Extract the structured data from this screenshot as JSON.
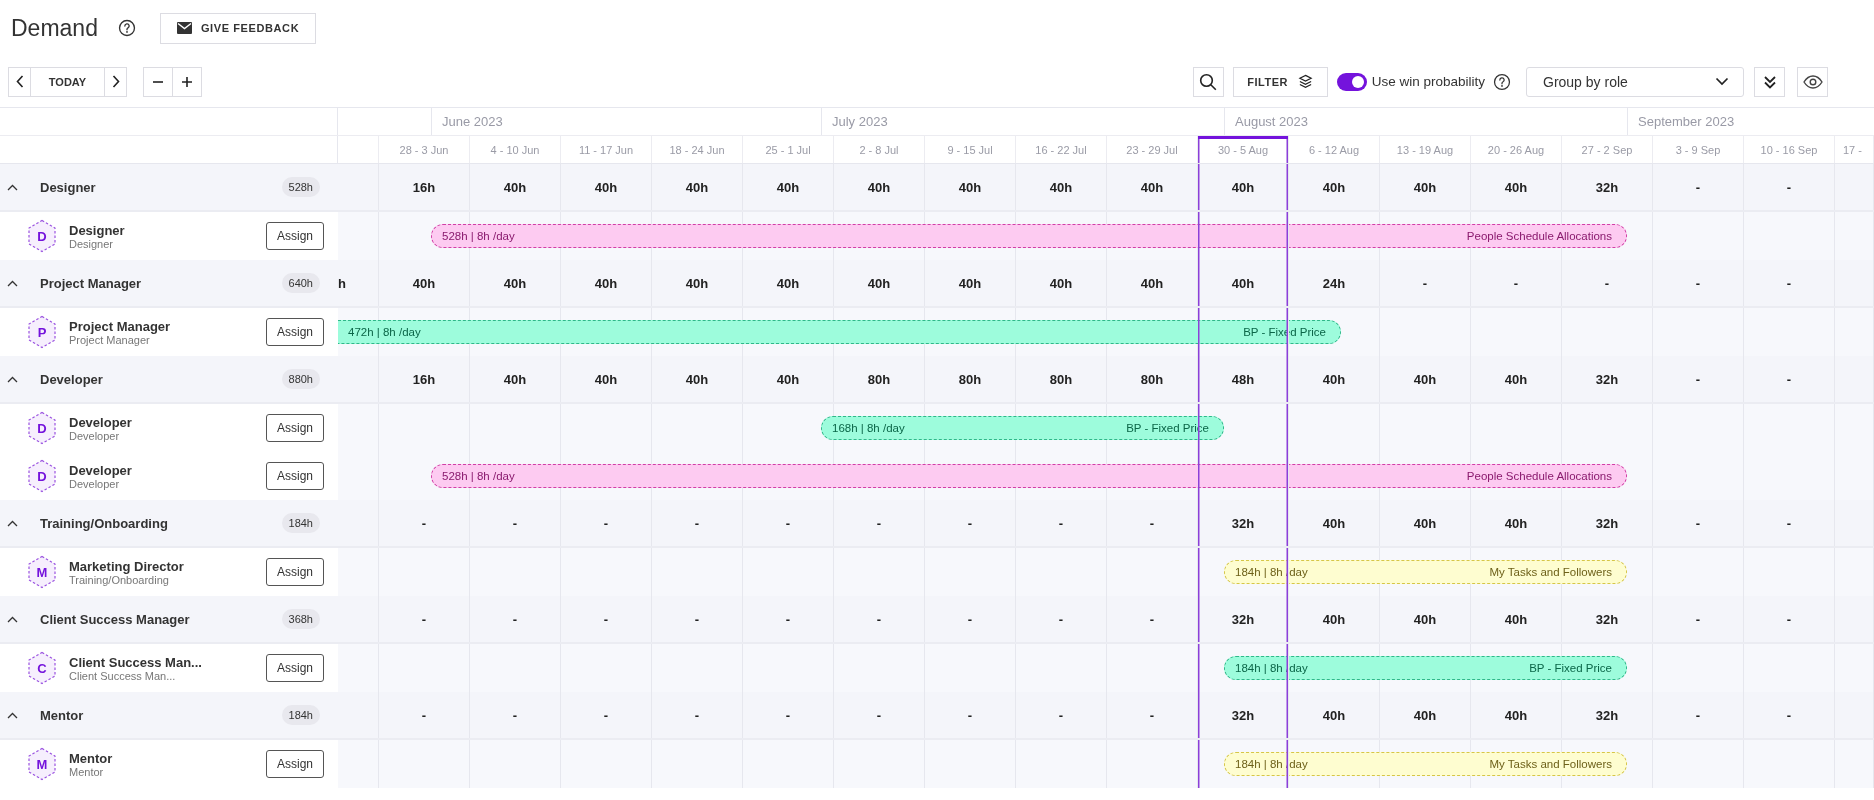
{
  "title": "Demand",
  "feedback_button": "GIVE FEEDBACK",
  "today_button": "TODAY",
  "filter_button": "FILTER",
  "win_probability": {
    "label": "Use win probability",
    "on": true
  },
  "group_by": {
    "value": "Group by role"
  },
  "months": [
    "June 2023",
    "July 2023",
    "August 2023",
    "September 2023"
  ],
  "weeks": [
    {
      "label": "28 - 3 Jun",
      "current": false
    },
    {
      "label": "4 - 10 Jun",
      "current": false
    },
    {
      "label": "11 - 17 Jun",
      "current": false
    },
    {
      "label": "18 - 24 Jun",
      "current": false
    },
    {
      "label": "25 - 1 Jul",
      "current": false
    },
    {
      "label": "2 - 8 Jul",
      "current": false
    },
    {
      "label": "9 - 15 Jul",
      "current": false
    },
    {
      "label": "16 - 22 Jul",
      "current": false
    },
    {
      "label": "23 - 29 Jul",
      "current": false
    },
    {
      "label": "30 - 5 Aug",
      "current": true
    },
    {
      "label": "6 - 12 Aug",
      "current": false
    },
    {
      "label": "13 - 19 Aug",
      "current": false
    },
    {
      "label": "20 - 26 Aug",
      "current": false
    },
    {
      "label": "27 - 2 Sep",
      "current": false
    },
    {
      "label": "3 - 9 Sep",
      "current": false
    },
    {
      "label": "10 - 16 Sep",
      "current": false
    },
    {
      "label": "17 -",
      "current": false
    }
  ],
  "groups": [
    {
      "name": "Designer",
      "total": "528h",
      "expanded": true,
      "hours": [
        "16h",
        "40h",
        "40h",
        "40h",
        "40h",
        "40h",
        "40h",
        "40h",
        "40h",
        "40h",
        "40h",
        "40h",
        "40h",
        "32h",
        "-",
        "-"
      ],
      "people": [
        {
          "initial": "D",
          "name": "Designer",
          "role": "Designer",
          "assign": "Assign",
          "allocation": {
            "hours": "528h | 8h /day",
            "source": "People Schedule Allocations",
            "color": "#fdcbf1"
          }
        }
      ]
    },
    {
      "name": "Project Manager",
      "total": "640h",
      "expanded": true,
      "cut_off_hours": "h",
      "hours": [
        "40h",
        "40h",
        "40h",
        "40h",
        "40h",
        "40h",
        "40h",
        "40h",
        "40h",
        "40h",
        "24h",
        "-",
        "-",
        "-",
        "-",
        "-"
      ],
      "people": [
        {
          "initial": "P",
          "name": "Project Manager",
          "role": "Project Manager",
          "assign": "Assign",
          "allocation": {
            "hours": "472h | 8h /day",
            "source": "BP - Fixed Price",
            "color": "#9dfcdc"
          }
        }
      ]
    },
    {
      "name": "Developer",
      "total": "880h",
      "expanded": true,
      "hours": [
        "16h",
        "40h",
        "40h",
        "40h",
        "40h",
        "80h",
        "80h",
        "80h",
        "80h",
        "48h",
        "40h",
        "40h",
        "40h",
        "32h",
        "-",
        "-"
      ],
      "people": [
        {
          "initial": "D",
          "name": "Developer",
          "role": "Developer",
          "assign": "Assign",
          "allocation": {
            "hours": "168h | 8h /day",
            "source": "BP - Fixed Price",
            "color": "#9dfcdc"
          }
        },
        {
          "initial": "D",
          "name": "Developer",
          "role": "Developer",
          "assign": "Assign",
          "allocation": {
            "hours": "528h | 8h /day",
            "source": "People Schedule Allocations",
            "color": "#fdcbf1"
          }
        }
      ]
    },
    {
      "name": "Training/Onboarding",
      "total": "184h",
      "expanded": true,
      "hours": [
        "-",
        "-",
        "-",
        "-",
        "-",
        "-",
        "-",
        "-",
        "-",
        "32h",
        "40h",
        "40h",
        "40h",
        "32h",
        "-",
        "-"
      ],
      "people": [
        {
          "initial": "M",
          "name": "Marketing Director",
          "role": "Training/Onboarding",
          "assign": "Assign",
          "allocation": {
            "hours": "184h | 8h /day",
            "source": "My Tasks and Followers",
            "color": "#fefdd0"
          }
        }
      ]
    },
    {
      "name": "Client Success Manager",
      "total": "368h",
      "expanded": true,
      "hours": [
        "-",
        "-",
        "-",
        "-",
        "-",
        "-",
        "-",
        "-",
        "-",
        "32h",
        "40h",
        "40h",
        "40h",
        "32h",
        "-",
        "-"
      ],
      "people": [
        {
          "initial": "C",
          "name": "Client Success Man...",
          "role": "Client Success Man...",
          "assign": "Assign",
          "allocation": {
            "hours": "184h | 8h /day",
            "source": "BP - Fixed Price",
            "color": "#9dfcdc"
          }
        }
      ]
    },
    {
      "name": "Mentor",
      "total": "184h",
      "expanded": true,
      "hours": [
        "-",
        "-",
        "-",
        "-",
        "-",
        "-",
        "-",
        "-",
        "-",
        "32h",
        "40h",
        "40h",
        "40h",
        "32h",
        "-",
        "-"
      ],
      "people": [
        {
          "initial": "M",
          "name": "Mentor",
          "role": "Mentor",
          "assign": "Assign",
          "allocation": {
            "hours": "184h | 8h /day",
            "source": "My Tasks and Followers",
            "color": "#fefdd0"
          }
        }
      ]
    }
  ]
}
